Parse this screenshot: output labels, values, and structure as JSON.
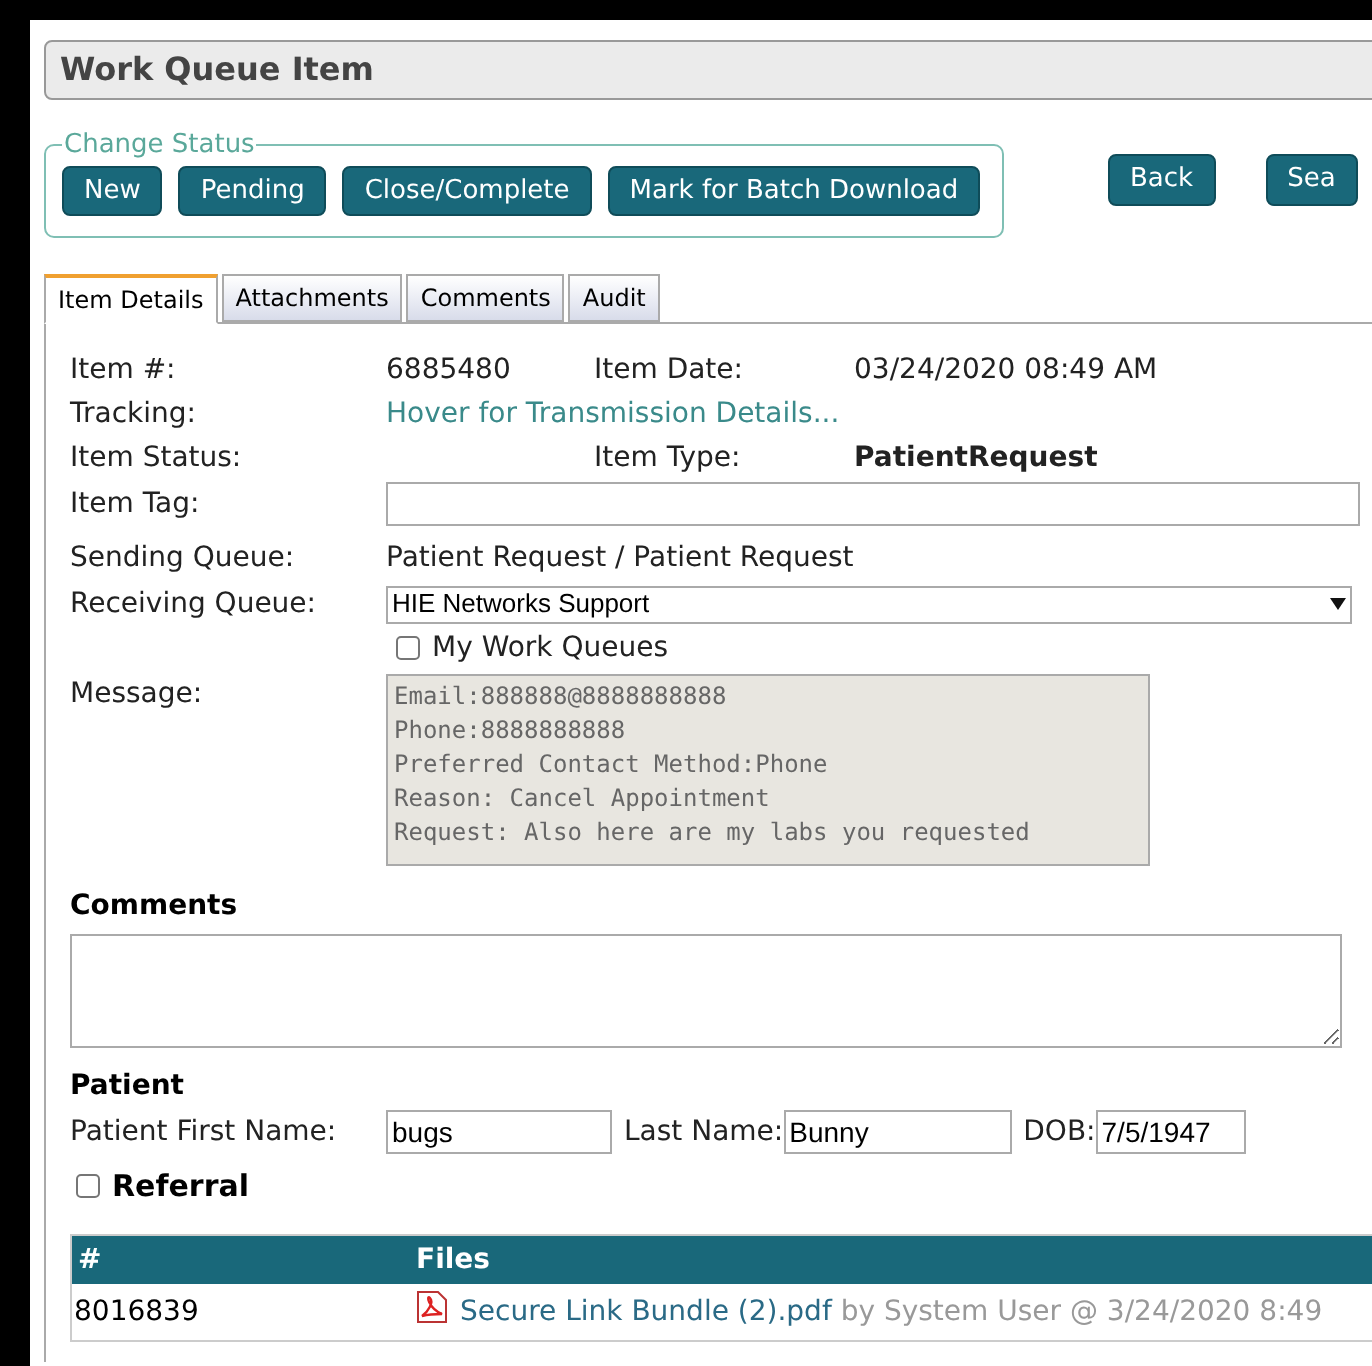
{
  "title": "Work Queue Item",
  "change_status": {
    "legend": "Change Status",
    "buttons": [
      "New",
      "Pending",
      "Close/Complete",
      "Mark for Batch Download"
    ]
  },
  "nav_buttons": [
    "Back",
    "Sea"
  ],
  "tabs": [
    {
      "label": "Item Details",
      "selected": true
    },
    {
      "label": "Attachments",
      "selected": false
    },
    {
      "label": "Comments",
      "selected": false
    },
    {
      "label": "Audit",
      "selected": false
    }
  ],
  "details": {
    "item_number_label": "Item #:",
    "item_number": "6885480",
    "item_date_label": "Item Date:",
    "item_date": "03/24/2020 08:49 AM",
    "tracking_label": "Tracking:",
    "tracking_link": "Hover for Transmission Details...",
    "item_status_label": "Item Status:",
    "item_type_label": "Item Type:",
    "item_type": "PatientRequest",
    "item_tag_label": "Item Tag:",
    "sending_queue_label": "Sending Queue:",
    "sending_queue": "Patient Request / Patient Request",
    "receiving_queue_label": "Receiving Queue:",
    "receiving_queue": "HIE Networks Support",
    "my_work_queues": {
      "label": "My Work Queues",
      "checked": false
    },
    "message_label": "Message:",
    "message_lines": [
      "Email:888888@8888888888",
      "Phone:8888888888",
      "Preferred Contact Method:Phone",
      "Reason: Cancel Appointment",
      "Request: Also here are my labs you requested"
    ]
  },
  "comments": {
    "heading": "Comments"
  },
  "patient": {
    "heading": "Patient",
    "first_name_label": "Patient First Name:",
    "first_name": "bugs",
    "last_name_label": "Last Name:",
    "last_name": "Bunny",
    "dob_label": "DOB:",
    "dob": "7/5/1947"
  },
  "referral": {
    "label": "Referral",
    "checked": false
  },
  "files_table": {
    "columns": [
      "#",
      "Files"
    ],
    "rows": [
      {
        "number": "8016839",
        "file": "Secure Link Bundle (2).pdf",
        "meta": "by System User @ 3/24/2020 8:49"
      }
    ]
  }
}
